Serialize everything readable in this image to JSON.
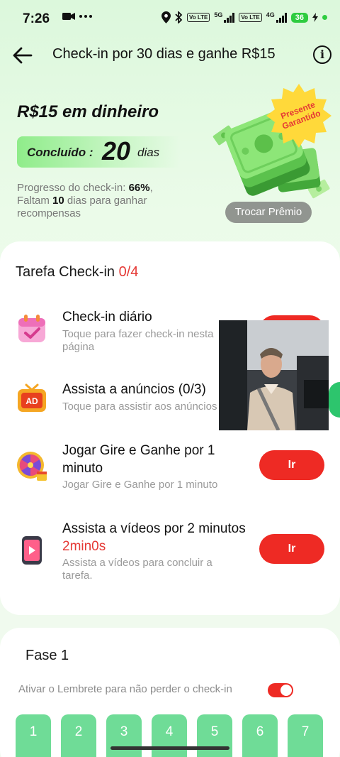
{
  "status_bar": {
    "time": "7:26",
    "left_icons": [
      "camera-icon",
      "more-dots-icon"
    ],
    "network_1": "5G",
    "network_2": "4G",
    "volte": "Vo LTE",
    "battery": "36"
  },
  "header": {
    "title": "Check-in por 30 dias e ganhe R$15"
  },
  "hero": {
    "reward_title": "R$15 em dinheiro",
    "completed_label": "Concluído :",
    "completed_days": "20",
    "completed_unit": "dias",
    "progress_prefix": "Progresso do check-in:",
    "progress_percent": "66%",
    "remaining_prefix": "Faltam",
    "remaining_days": "10",
    "remaining_suffix": "dias para ganhar recompensas",
    "badge_line1": "Presente",
    "badge_line2": "Garantido",
    "trade_button": "Trocar Prêmio"
  },
  "tasks": {
    "title": "Tarefa Check-in",
    "count": "0/4",
    "items": [
      {
        "name": "Check-in diário",
        "desc": "Toque para fazer check-in nesta página",
        "icon": "calendar-check-icon",
        "button": ""
      },
      {
        "name": "Assista a anúncios  (0/3)",
        "desc": "Toque para assistir aos anúncios",
        "icon": "ad-tv-icon",
        "button": ""
      },
      {
        "name": "Jogar Gire e Ganhe por 1 minuto",
        "desc": "Jogar Gire e Ganhe por 1 minuto",
        "icon": "prize-wheel-icon",
        "button": "Ir"
      },
      {
        "name": "Assista a vídeos por 2 minutos",
        "timer": "2min0s",
        "desc": "Assista a vídeos para concluir a tarefa.",
        "icon": "video-phone-icon",
        "button": "Ir"
      }
    ]
  },
  "phase": {
    "title": "Fase 1",
    "reminder": "Ativar o Lembrete para não perder o check-in",
    "reminder_enabled": true,
    "days": [
      "1",
      "2",
      "3",
      "4",
      "5",
      "6",
      "7"
    ]
  },
  "colors": {
    "accent_red": "#ee2a24",
    "accent_green": "#6fdc97",
    "background_green": "#dcf8dc"
  }
}
